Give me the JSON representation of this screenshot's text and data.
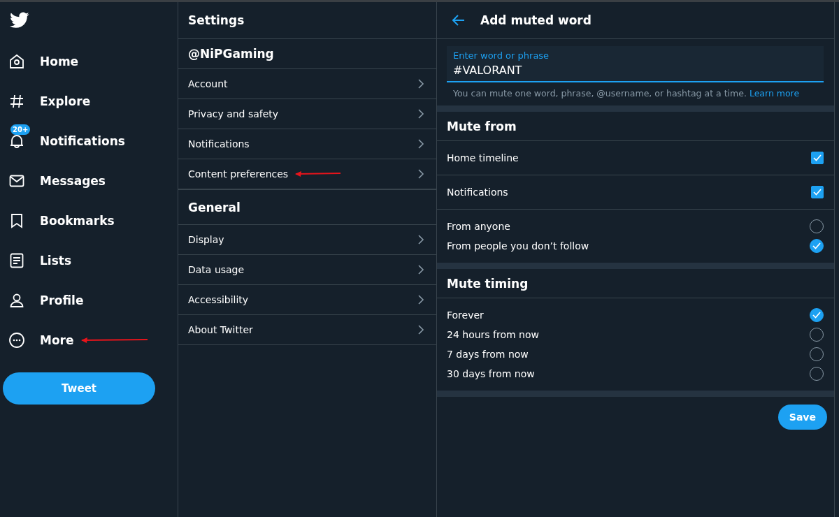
{
  "nav": {
    "items": [
      {
        "label": "Home",
        "selected": false,
        "annotated": false
      },
      {
        "label": "Explore",
        "selected": false,
        "annotated": false
      },
      {
        "label": "Notifications",
        "badge": "20+",
        "selected": false,
        "annotated": false
      },
      {
        "label": "Messages",
        "selected": false,
        "annotated": false
      },
      {
        "label": "Bookmarks",
        "selected": false,
        "annotated": false
      },
      {
        "label": "Lists",
        "selected": false,
        "annotated": false
      },
      {
        "label": "Profile",
        "selected": false,
        "annotated": false
      },
      {
        "label": "More",
        "selected": false,
        "annotated": true
      }
    ],
    "tweet_button": "Tweet"
  },
  "settings": {
    "title": "Settings",
    "sections": [
      {
        "title": "@NiPGaming",
        "items": [
          {
            "label": "Account",
            "annotated": false
          },
          {
            "label": "Privacy and safety",
            "annotated": false
          },
          {
            "label": "Notifications",
            "annotated": false
          },
          {
            "label": "Content preferences",
            "annotated": true
          }
        ]
      },
      {
        "title": "General",
        "items": [
          {
            "label": "Display",
            "annotated": false
          },
          {
            "label": "Data usage",
            "annotated": false
          },
          {
            "label": "Accessibility",
            "annotated": false
          },
          {
            "label": "About Twitter",
            "annotated": false
          }
        ]
      }
    ]
  },
  "muted_word": {
    "title": "Add muted word",
    "field": {
      "label": "Enter word or phrase",
      "value": "#VALORANT"
    },
    "hint": "You can mute one word, phrase, @username, or hashtag at a time.",
    "hint_link": "Learn more",
    "sections": [
      {
        "title": "Mute from",
        "options": [
          {
            "kind": "checkbox",
            "label": "Home timeline",
            "checked": true
          },
          {
            "kind": "checkbox",
            "label": "Notifications",
            "checked": true
          },
          {
            "kind": "radio",
            "label": "From anyone",
            "selected": false
          },
          {
            "kind": "radio",
            "label": "From people you don’t follow",
            "selected": true
          }
        ]
      },
      {
        "title": "Mute timing",
        "options": [
          {
            "kind": "radio",
            "label": "Forever",
            "selected": true
          },
          {
            "kind": "radio",
            "label": "24 hours from now",
            "selected": false
          },
          {
            "kind": "radio",
            "label": "7 days from now",
            "selected": false
          },
          {
            "kind": "radio",
            "label": "30 days from now",
            "selected": false
          }
        ]
      }
    ],
    "save_button": "Save"
  }
}
